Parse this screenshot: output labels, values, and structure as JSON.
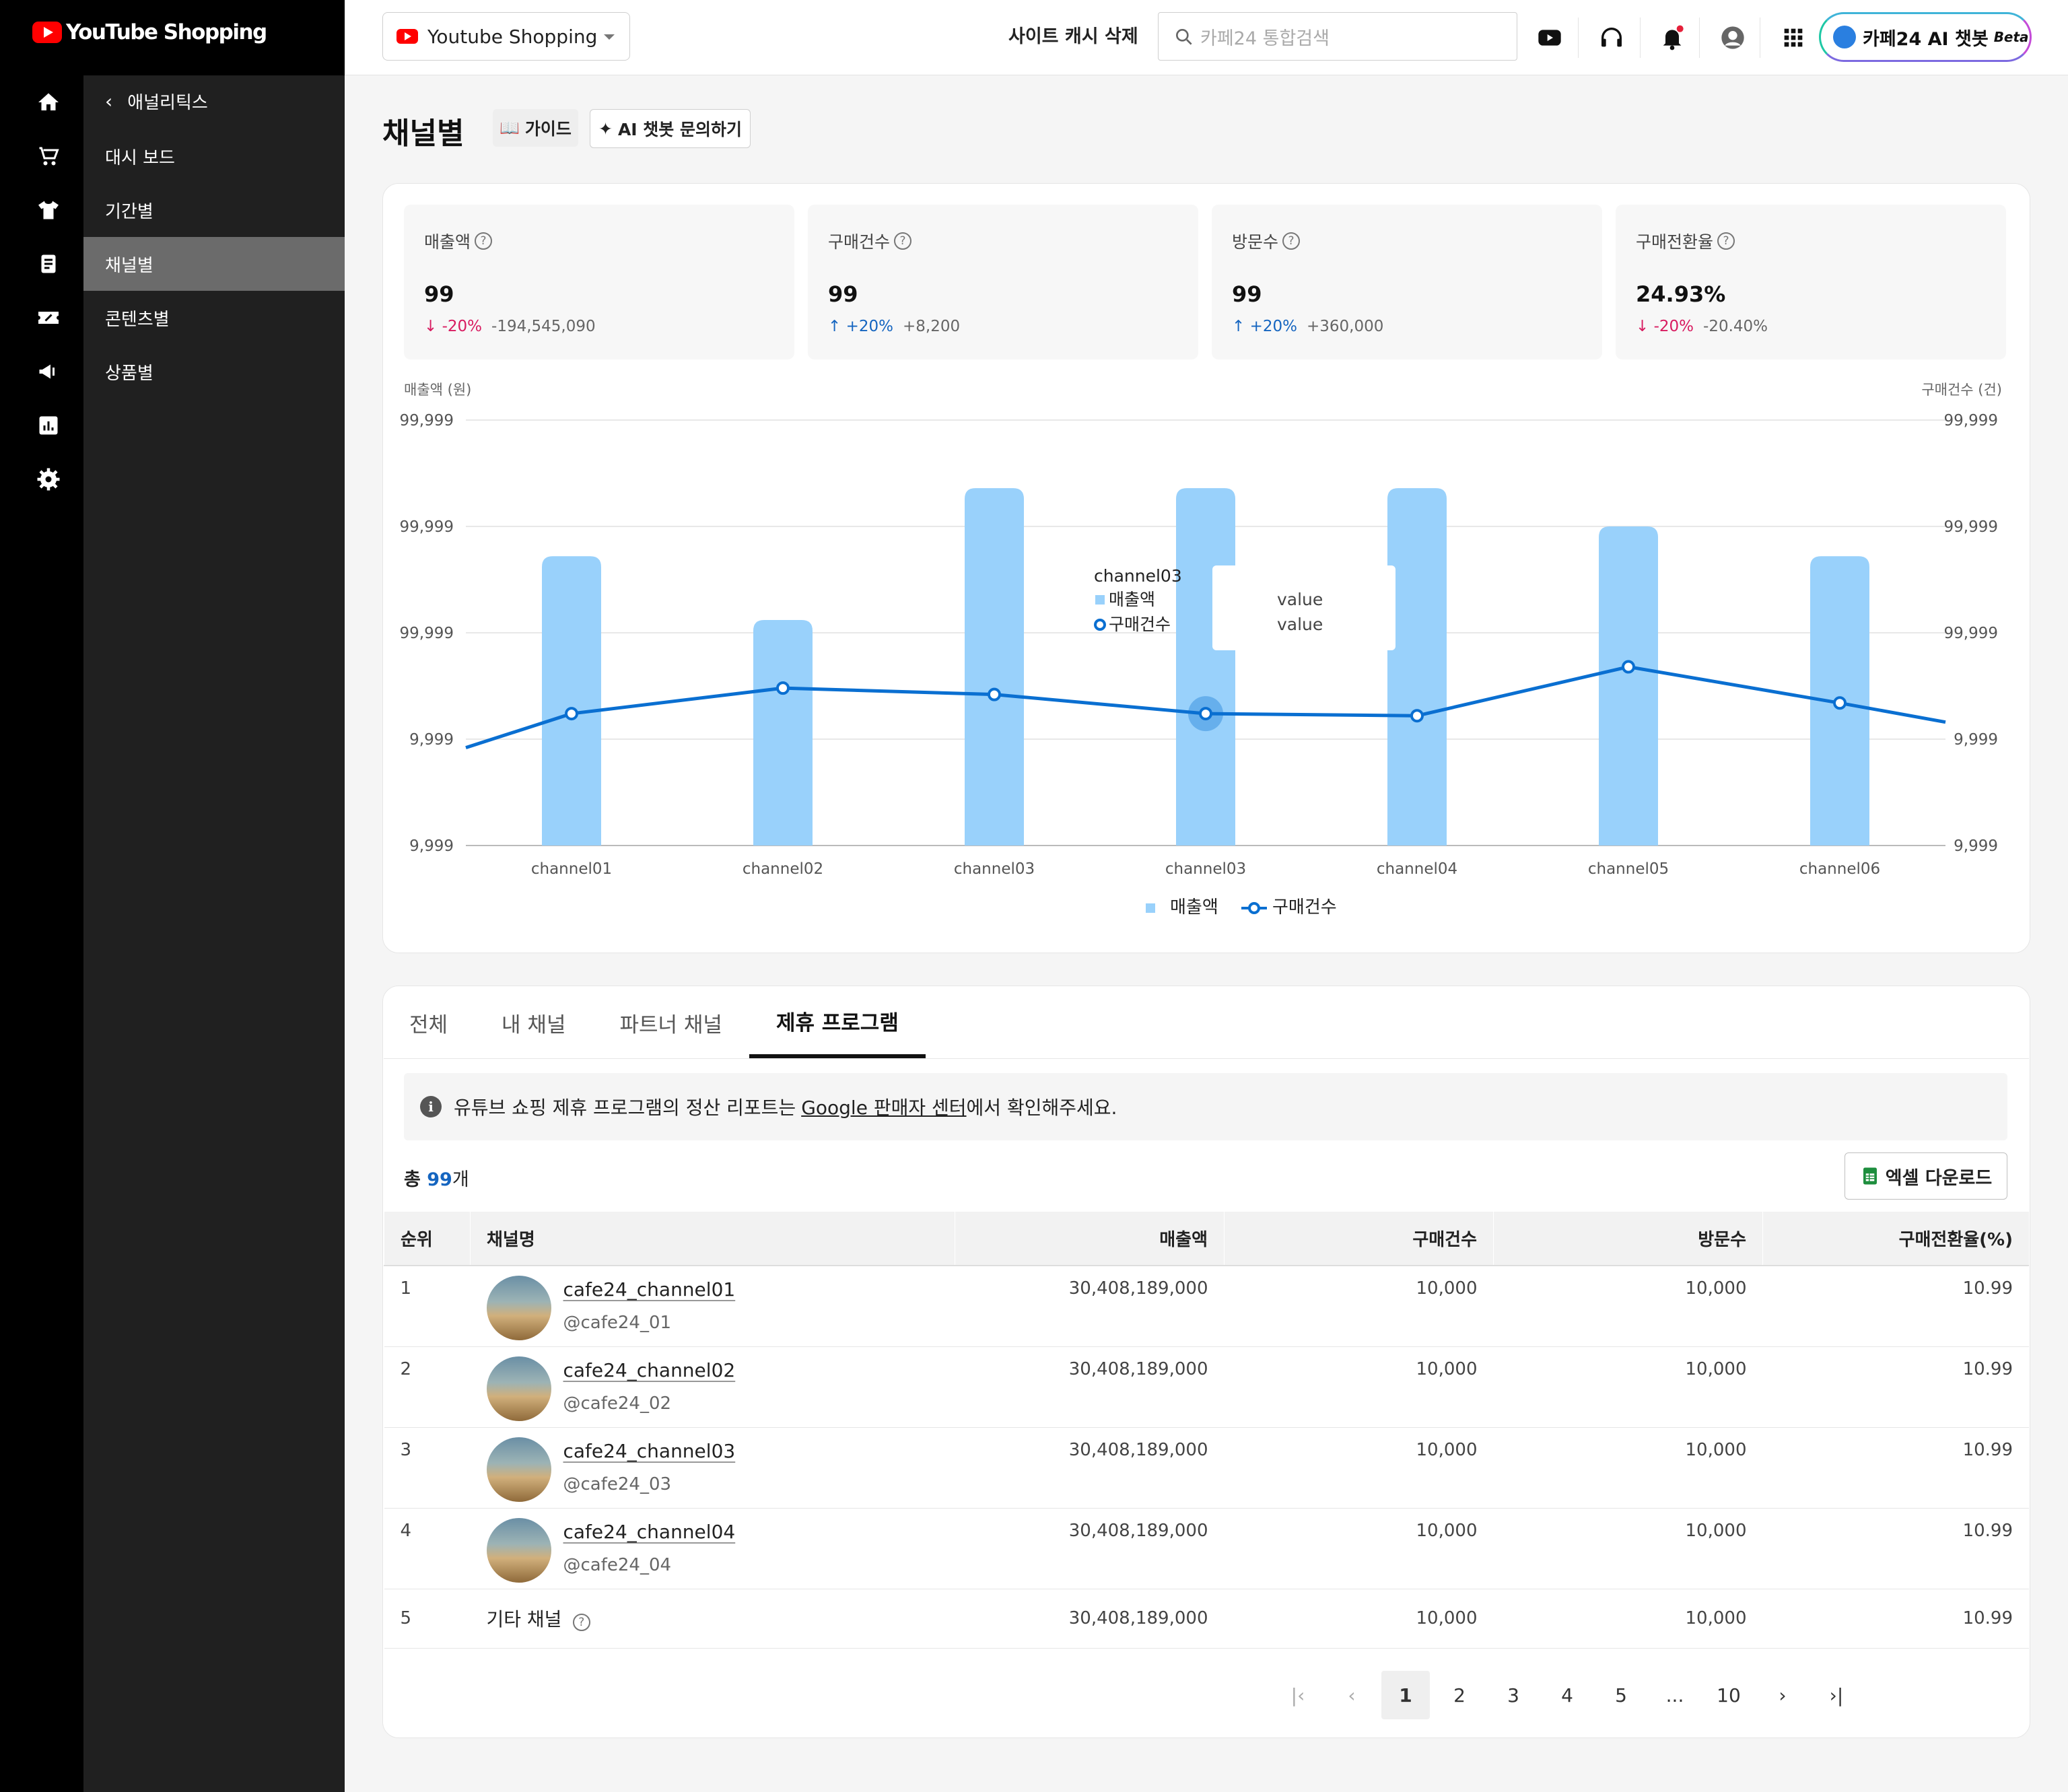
{
  "app": {
    "logo": "YouTube Shopping"
  },
  "sidebar": {
    "back_label": "애널리틱스",
    "items": [
      {
        "label": "대시 보드"
      },
      {
        "label": "기간별"
      },
      {
        "label": "채널별",
        "active": true
      },
      {
        "label": "콘텐츠별"
      },
      {
        "label": "상품별"
      }
    ]
  },
  "topbar": {
    "shop_select": "Youtube Shopping",
    "cache_label": "사이트 캐시 삭제",
    "search_placeholder": "카페24 통합검색",
    "ai_chatbot": "카페24 AI 챗봇",
    "ai_badge": "Beta"
  },
  "page": {
    "title": "채널별",
    "guide_label": "가이드",
    "ai_ask_label": "AI 챗봇 문의하기"
  },
  "kpis": [
    {
      "label": "매출액",
      "value": "99",
      "pct": "-20%",
      "diff": "-194,545,090",
      "dir": "down"
    },
    {
      "label": "구매건수",
      "value": "99",
      "pct": "+20%",
      "diff": "+8,200",
      "dir": "up"
    },
    {
      "label": "방문수",
      "value": "99",
      "pct": "+20%",
      "diff": "+360,000",
      "dir": "up"
    },
    {
      "label": "구매전환율",
      "value": "24.93%",
      "pct": "-20%",
      "diff": "-20.40%",
      "dir": "down"
    }
  ],
  "chart_data": {
    "type": "bar",
    "left_axis_title": "매출액 (원)",
    "right_axis_title": "구매건수 (건)",
    "left_ticks": [
      "99,999",
      "99,999",
      "99,999",
      "9,999",
      "9,999"
    ],
    "right_ticks": [
      "99,999",
      "99,999",
      "99,999",
      "9,999",
      "9,999"
    ],
    "categories": [
      "channel01",
      "channel02",
      "channel03",
      "channel03",
      "channel04",
      "channel05",
      "channel06"
    ],
    "series": [
      {
        "name": "매출액",
        "type": "bar",
        "color": "#99d1fb",
        "values": [
          0.68,
          0.53,
          0.84,
          0.84,
          0.84,
          0.75,
          0.68
        ]
      },
      {
        "name": "구매건수",
        "type": "line",
        "color": "#0a6fd1",
        "values": [
          0.31,
          0.37,
          0.355,
          0.31,
          0.305,
          0.42,
          0.335
        ]
      }
    ],
    "line_edge_values": [
      0.23,
      0.29
    ],
    "tooltip": {
      "title": "channel03",
      "rows": [
        {
          "name": "매출액",
          "value": "value"
        },
        {
          "name": "구매건수",
          "value": "value"
        }
      ],
      "category_index": 3
    },
    "legend": [
      "매출액",
      "구매건수"
    ]
  },
  "tabs": [
    {
      "label": "전체"
    },
    {
      "label": "내 채널"
    },
    {
      "label": "파트너 채널"
    },
    {
      "label": "제휴 프로그램",
      "active": true
    }
  ],
  "notice": {
    "before": "유튜브 쇼핑 제휴 프로그램의 정산 리포트는",
    "link": "Google 판매자 센터",
    "after": "에서 확인해주세요."
  },
  "total": {
    "prefix": "총",
    "count": "99",
    "suffix": "개"
  },
  "excel_label": "엑셀 다운로드",
  "table": {
    "headers": [
      "순위",
      "채널명",
      "매출액",
      "구매건수",
      "방문수",
      "구매전환율(%)"
    ],
    "rows": [
      {
        "rank": "1",
        "name": "cafe24_channel01",
        "handle": "@cafe24_01",
        "sales": "30,408,189,000",
        "orders": "10,000",
        "visits": "10,000",
        "rate": "10.99"
      },
      {
        "rank": "2",
        "name": "cafe24_channel02",
        "handle": "@cafe24_02",
        "sales": "30,408,189,000",
        "orders": "10,000",
        "visits": "10,000",
        "rate": "10.99"
      },
      {
        "rank": "3",
        "name": "cafe24_channel03",
        "handle": "@cafe24_03",
        "sales": "30,408,189,000",
        "orders": "10,000",
        "visits": "10,000",
        "rate": "10.99"
      },
      {
        "rank": "4",
        "name": "cafe24_channel04",
        "handle": "@cafe24_04",
        "sales": "30,408,189,000",
        "orders": "10,000",
        "visits": "10,000",
        "rate": "10.99"
      }
    ],
    "other": {
      "rank": "5",
      "name": "기타 채널",
      "sales": "30,408,189,000",
      "orders": "10,000",
      "visits": "10,000",
      "rate": "10.99"
    }
  },
  "pagination": {
    "pages": [
      "1",
      "2",
      "3",
      "4",
      "5",
      "...",
      "10"
    ],
    "current": "1"
  }
}
